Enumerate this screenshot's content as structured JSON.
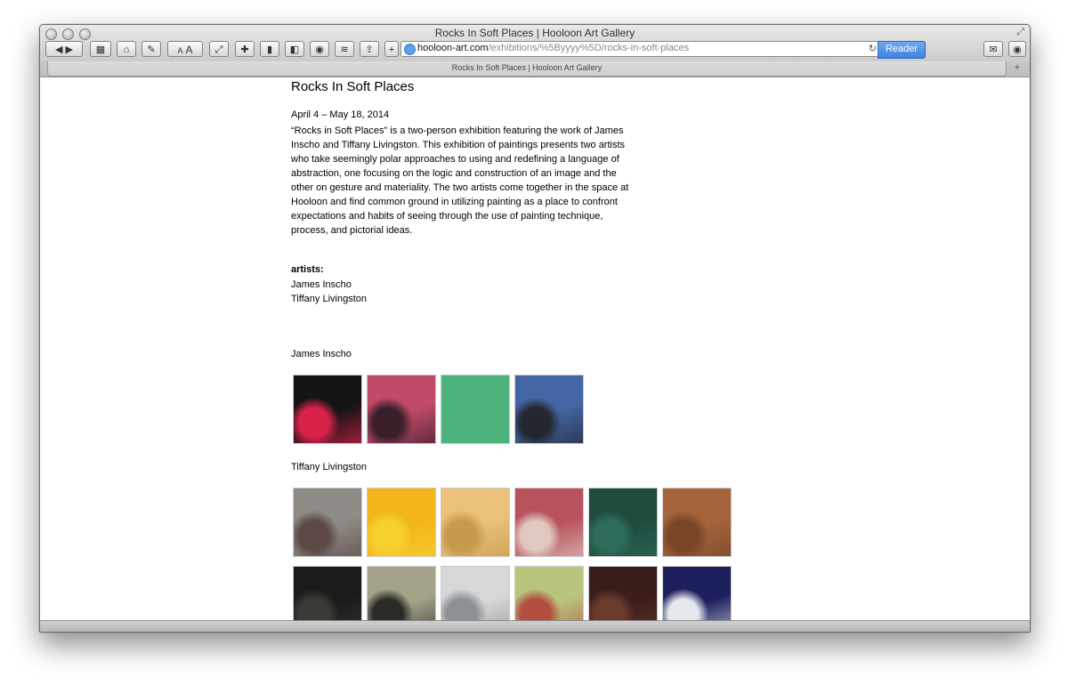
{
  "window": {
    "title": "Rocks In Soft Places | Hooloon Art Gallery"
  },
  "toolbar": {
    "font_small": "A",
    "font_large": "A",
    "add_label": "+",
    "url_domain": "hooloon-art.com",
    "url_path": "/exhibitions/%5Byyyy%5D/rocks-in-soft-places",
    "reader_label": "Reader"
  },
  "tabs": [
    {
      "label": "Rocks In Soft Places | Hooloon Art Gallery"
    }
  ],
  "page": {
    "title": "Rocks In Soft Places",
    "dates": "April 4  –  May 18, 2014",
    "description": "“Rocks in Soft Places” is a two-person exhibition featuring the work of James Inscho and Tiffany Livingston.  This exhibition of paintings presents two artists who take seemingly polar approaches to using and redefining a language of abstraction, one focusing on the logic and construction of an image and the other on gesture and materiality. The two artists come together in the space at Hooloon and find common ground in utilizing painting as a place to confront expectations and habits of seeing through the use of painting technique, process, and pictorial ideas.",
    "artists_heading": "artists:",
    "artists": [
      "James Inscho",
      "Tiffany Livingston"
    ],
    "sections": [
      {
        "artist": "James Inscho",
        "thumbnails": [
          {
            "bg": "#141414",
            "accent": "#d8224a"
          },
          {
            "bg": "#c04a67",
            "accent": "#3a1f2b"
          },
          {
            "bg": "#4db37d",
            "accent": "#4db37d"
          },
          {
            "bg": "#4465a4",
            "accent": "#23272f"
          }
        ]
      },
      {
        "artist": "Tiffany Livingston",
        "thumbnails": [
          {
            "bg": "#8f8b86",
            "accent": "#5c4946"
          },
          {
            "bg": "#f2b51c",
            "accent": "#f7d030"
          },
          {
            "bg": "#eac07a",
            "accent": "#c59a4c"
          },
          {
            "bg": "#b8525c",
            "accent": "#e0c7bf"
          },
          {
            "bg": "#1f4a3e",
            "accent": "#2d6c5a"
          },
          {
            "bg": "#a5643c",
            "accent": "#7a4526"
          },
          {
            "bg": "#1b1a19",
            "accent": "#3c3a37"
          },
          {
            "bg": "#a4a38a",
            "accent": "#2b2b25"
          },
          {
            "bg": "#d6d8d8",
            "accent": "#8c8f94"
          },
          {
            "bg": "#b8c57d",
            "accent": "#b34d3e"
          },
          {
            "bg": "#3a1d1a",
            "accent": "#6b3a2e"
          },
          {
            "bg": "#1d1f5c",
            "accent": "#e6e8f0"
          }
        ]
      }
    ]
  }
}
